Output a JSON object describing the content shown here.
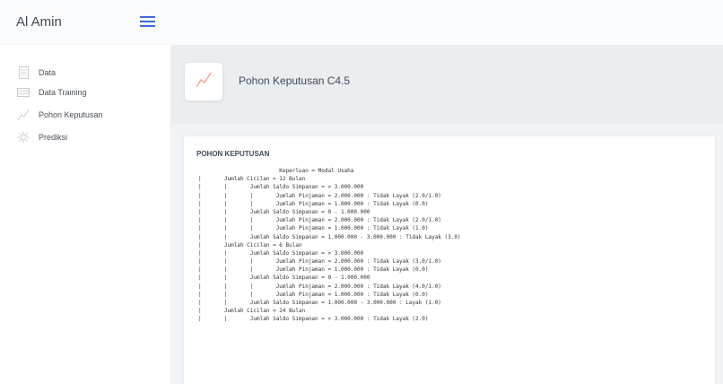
{
  "header": {
    "brand": "Al Amin"
  },
  "sidebar": {
    "items": [
      {
        "label": "Data",
        "icon": "document-icon"
      },
      {
        "label": "Data Training",
        "icon": "table-icon"
      },
      {
        "label": "Pohon Keputusan",
        "icon": "chart-line-icon"
      },
      {
        "label": "Prediksi",
        "icon": "gear-icon"
      }
    ]
  },
  "page": {
    "title": "Pohon Keputusan C4.5"
  },
  "card": {
    "title": "POHON KEPUTUSAN",
    "tree_lines": [
      "                         Keperluan = Modal Usaha",
      "|       Jumlah Cicilan = 12 Bulan",
      "|       |       Jumlah Saldo Simpanan = > 3.000.000",
      "|       |       |       Jumlah Pinjaman = 2.000.000 : Tidak Layak (2.0/1.0)",
      "|       |       |       Jumlah Pinjaman = 1.000.000 : Tidak Layak (0.0)",
      "|       |       Jumlah Saldo Simpanan = 0 - 1.000.000",
      "|       |       |       Jumlah Pinjaman = 2.000.000 : Tidak Layak (2.0/1.0)",
      "|       |       |       Jumlah Pinjaman = 1.000.000 : Tidak Layak (1.0)",
      "|       |       Jumlah Saldo Simpanan = 1.000.000 - 3.000.000 : Tidak Layak (3.0)",
      "|       Jumlah Cicilan = 6 Bulan",
      "|       |       Jumlah Saldo Simpanan = > 3.000.000",
      "|       |       |       Jumlah Pinjaman = 2.000.000 : Tidak Layak (3.0/1.0)",
      "|       |       |       Jumlah Pinjaman = 1.000.000 : Tidak Layak (0.0)",
      "|       |       Jumlah Saldo Simpanan = 0 - 1.000.000",
      "|       |       |       Jumlah Pinjaman = 2.000.000 : Tidak Layak (4.0/1.0)",
      "|       |       |       Jumlah Pinjaman = 1.000.000 : Tidak Layak (0.0)",
      "|       |       Jumlah Saldo Simpanan = 1.000.000 - 3.000.000 : Layak (1.0)",
      "|       Jumlah Cicilan = 24 Bulan",
      "|       |       Jumlah Saldo Simpanan = > 3.000.000 : Tidak Layak (2.0)"
    ]
  }
}
